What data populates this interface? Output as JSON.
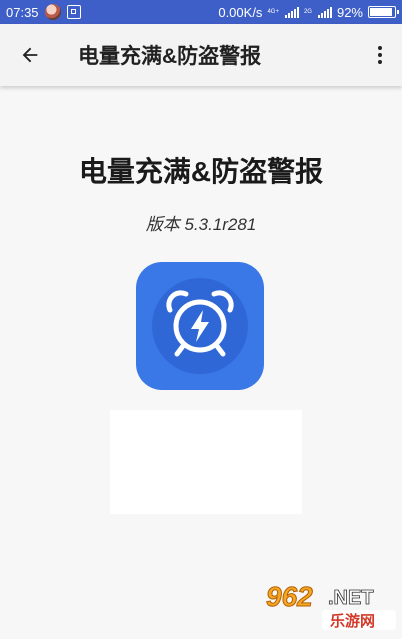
{
  "status_bar": {
    "time": "07:35",
    "speed": "0.00K/s",
    "network_top": "4G+",
    "network_bottom": "2G",
    "battery": "92%",
    "battery_level": 0.92,
    "color": "#3f5fc8"
  },
  "toolbar": {
    "title": "电量充满&防盗警报"
  },
  "about": {
    "app_name": "电量充满&防盗警报",
    "version": "版本 5.3.1r281",
    "icon_color": "#3b78e7"
  },
  "watermark": {
    "number": "962",
    "domain": ".NET",
    "cn_name": "乐游网"
  }
}
